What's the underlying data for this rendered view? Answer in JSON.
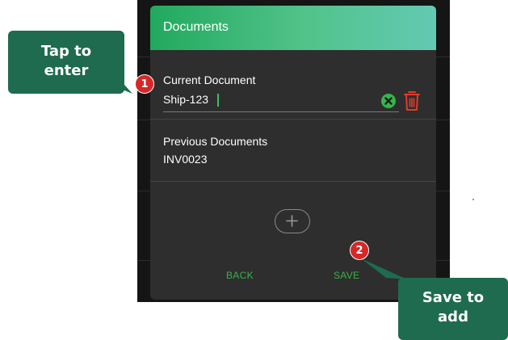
{
  "dialog": {
    "title": "Documents",
    "current_label": "Current Document",
    "current_value": "Ship-123",
    "previous_label": "Previous Documents",
    "previous_value": "INV0023",
    "back_label": "BACK",
    "save_label": "SAVE"
  },
  "icons": {
    "clear": "clear-circle-x",
    "delete": "trash-can",
    "add": "plus"
  },
  "callouts": {
    "tap": "Tap to enter",
    "save": "Save to add"
  },
  "markers": {
    "step1": "1",
    "step2": "2"
  },
  "colors": {
    "header_start": "#22a95e",
    "header_end": "#63c9b3",
    "accent_green": "#37b34a",
    "delete_red": "#e23b2a",
    "callout_bg": "#1e6b4f",
    "marker_red": "#d62828"
  }
}
